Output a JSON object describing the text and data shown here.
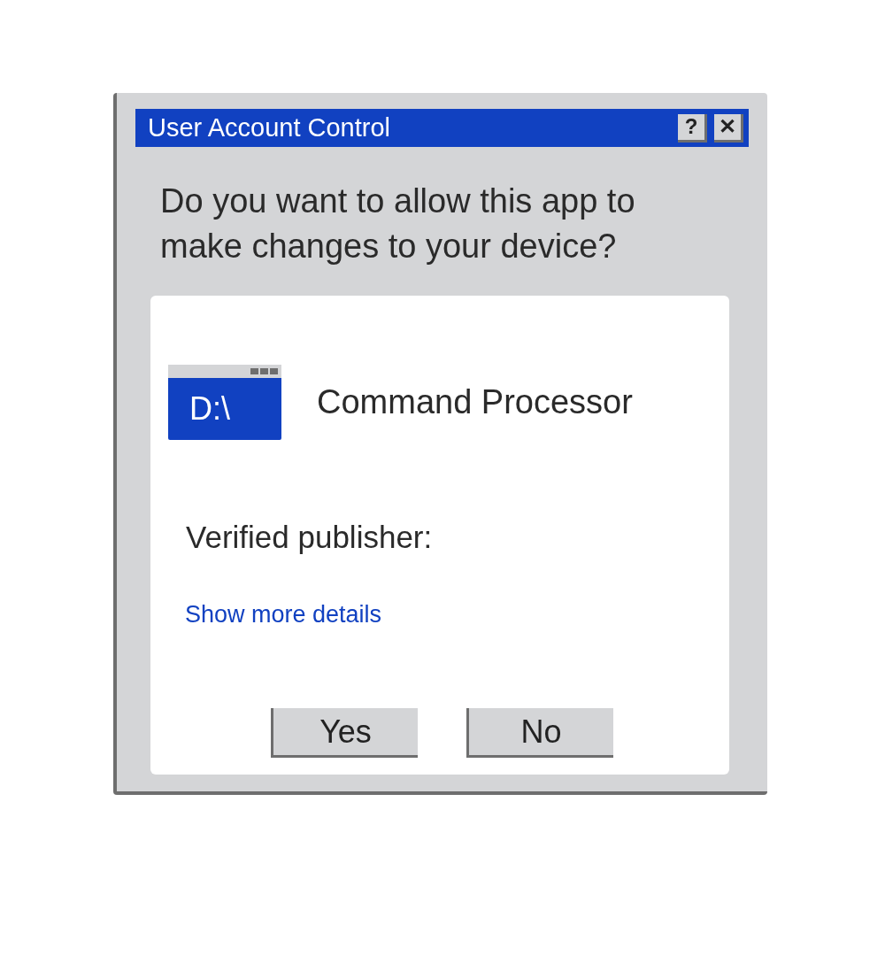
{
  "window": {
    "title": "User Account Control",
    "title_buttons": [
      "?",
      "✕"
    ]
  },
  "prompt": "Do you want to allow this app to make changes to your device?",
  "app": {
    "icon_text": "D:\\",
    "name": "Command Processor"
  },
  "publisher_label": "Verified publisher:",
  "details_link": "Show more details",
  "buttons": [
    "Yes",
    "No"
  ]
}
